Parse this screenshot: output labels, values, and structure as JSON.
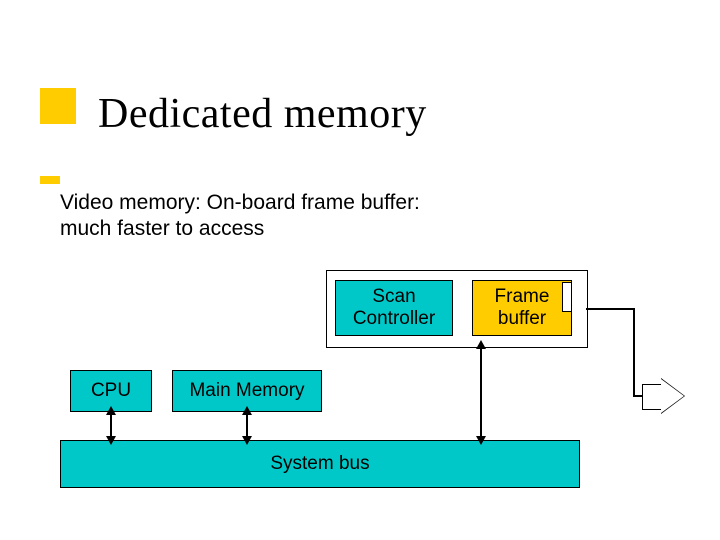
{
  "title": "Dedicated memory",
  "description": "Video memory: On-board frame buffer:\nmuch faster to access",
  "boxes": {
    "scan_controller": "Scan\nController",
    "frame_buffer": "Frame\nbuffer",
    "cpu": "CPU",
    "main_memory": "Main Memory",
    "system_bus": "System bus"
  }
}
